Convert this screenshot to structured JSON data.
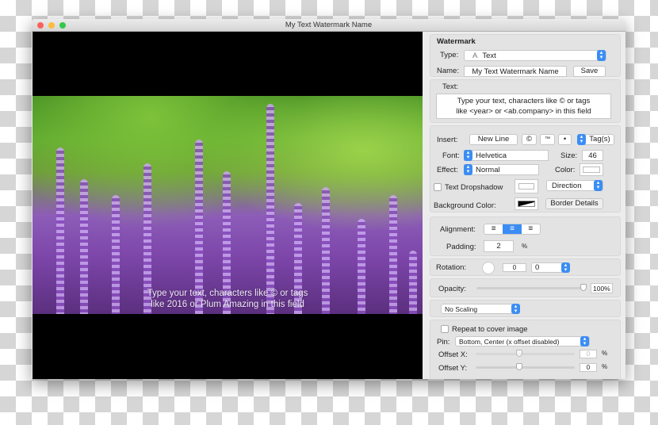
{
  "window": {
    "title": "My Text Watermark Name"
  },
  "preview": {
    "watermark_line1": "Type your text, characters like © or tags",
    "watermark_line2": "like 2016 or Plum Amazing in this field"
  },
  "watermark": {
    "heading": "Watermark",
    "type_label": "Type:",
    "type_icon": "A",
    "type_value": "Text",
    "name_label": "Name:",
    "name_value": "My Text Watermark Name",
    "save": "Save"
  },
  "text": {
    "label": "Text:",
    "line1": "Type your text, characters like © or tags",
    "line2": "like <year> or <ab.company> in this field"
  },
  "insert": {
    "label": "Insert:",
    "new_line": "New Line",
    "copyright": "©",
    "trademark": "™",
    "bullet": "•",
    "tags": "Tag(s)"
  },
  "font": {
    "label": "Font:",
    "value": "Helvetica",
    "size_label": "Size:",
    "size": "46",
    "effect_label": "Effect:",
    "effect": "Normal",
    "color_label": "Color:",
    "dropshadow": "Text Dropshadow",
    "dropshadow_checked": false,
    "direction": "Direction",
    "bg_label": "Background Color:",
    "border_details": "Border Details"
  },
  "alignment": {
    "label": "Alignment:",
    "selected": "center",
    "padding_label": "Padding:",
    "padding": "2",
    "padding_unit": "%"
  },
  "rotation": {
    "label": "Rotation:",
    "value": "0",
    "select": "0"
  },
  "opacity": {
    "label": "Opacity:",
    "value": "100%",
    "percent": 100
  },
  "scaling": {
    "value": "No Scaling"
  },
  "position": {
    "repeat": "Repeat to cover image",
    "repeat_checked": false,
    "pin_label": "Pin:",
    "pin": "Bottom, Center (x offset disabled)",
    "offx_label": "Offset X:",
    "offx": "0",
    "offy_label": "Offset Y:",
    "offy": "0",
    "unit": "%"
  },
  "colors": {
    "accent": "#3b8df5"
  }
}
